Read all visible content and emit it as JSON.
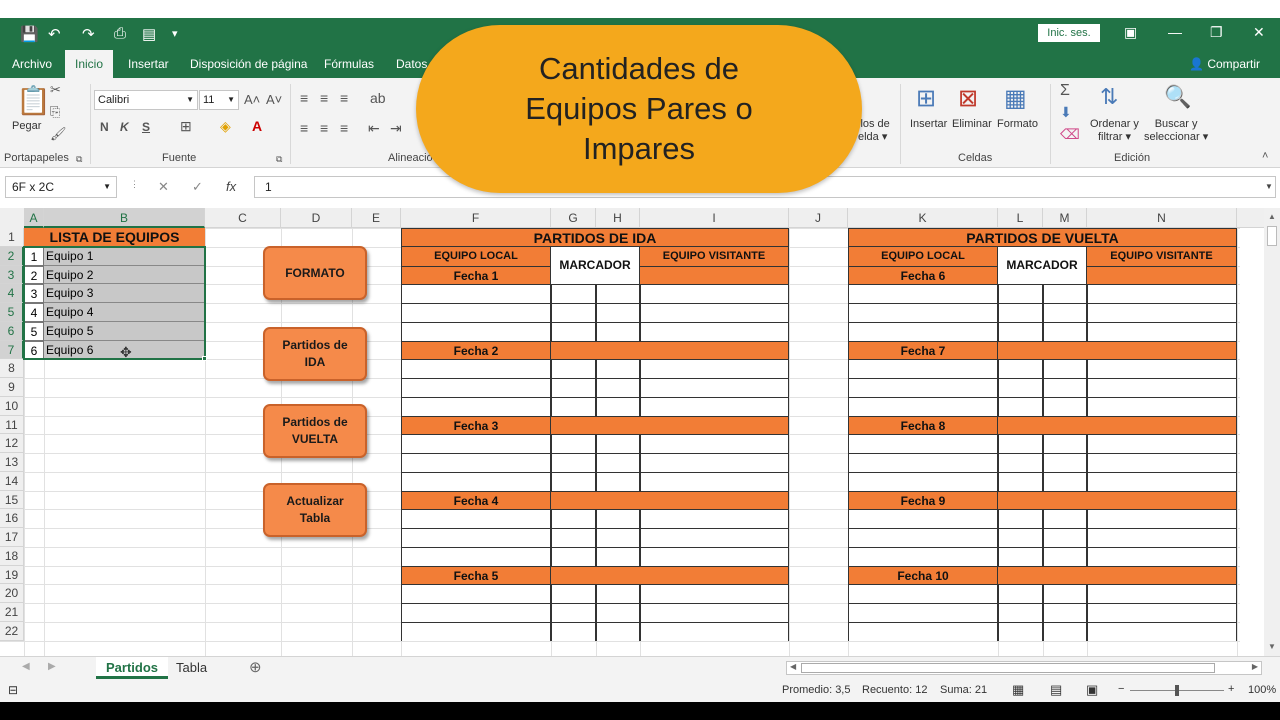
{
  "titlebar": {
    "signin": "Inic. ses."
  },
  "tabs": [
    "Archivo",
    "Inicio",
    "Insertar",
    "Disposición de página",
    "Fórmulas",
    "Datos"
  ],
  "share": "Compartir",
  "ribbon": {
    "paste": "Pegar",
    "font_name": "Calibri",
    "font_size": "11",
    "bold": "N",
    "italic": "K",
    "underline": "S",
    "groups": {
      "clipboard": "Portapapeles",
      "font": "Fuente",
      "alignment": "Alineació",
      "cells": "Celdas",
      "editing": "Edición"
    },
    "insert": "Insertar",
    "delete": "Eliminar",
    "format": "Formato",
    "cell_styles_1": "ilos de",
    "cell_styles_2": "elda",
    "sort_1": "Ordenar y",
    "sort_2": "filtrar",
    "find_1": "Buscar y",
    "find_2": "seleccionar"
  },
  "formula_bar": {
    "name_box": "6F x 2C",
    "value": "1",
    "fx": "fx"
  },
  "columns": [
    "A",
    "B",
    "C",
    "D",
    "E",
    "F",
    "G",
    "H",
    "I",
    "J",
    "K",
    "L",
    "M",
    "N"
  ],
  "rows": [
    "1",
    "2",
    "3",
    "4",
    "5",
    "6",
    "7",
    "8",
    "9",
    "10",
    "11",
    "12",
    "13",
    "14",
    "15",
    "16",
    "17",
    "18",
    "19",
    "20",
    "21",
    "22"
  ],
  "team_list": {
    "title": "LISTA DE EQUIPOS",
    "numbers": [
      "1",
      "2",
      "3",
      "4",
      "5",
      "6"
    ],
    "teams": [
      "Equipo 1",
      "Equipo 2",
      "Equipo 3",
      "Equipo 4",
      "Equipo 5",
      "Equipo 6"
    ]
  },
  "buttons": {
    "formato": "FORMATO",
    "ida_1": "Partidos de",
    "ida_2": "IDA",
    "vuelta_1": "Partidos de",
    "vuelta_2": "VUELTA",
    "actualizar_1": "Actualizar",
    "actualizar_2": "Tabla"
  },
  "ida": {
    "title": "PARTIDOS DE IDA",
    "local": "EQUIPO LOCAL",
    "marcador": "MARCADOR",
    "visitante": "EQUIPO VISITANTE",
    "fechas": [
      "Fecha 1",
      "Fecha 2",
      "Fecha 3",
      "Fecha 4",
      "Fecha 5"
    ]
  },
  "vuelta": {
    "title": "PARTIDOS DE VUELTA",
    "local": "EQUIPO LOCAL",
    "marcador": "MARCADOR",
    "visitante": "EQUIPO VISITANTE",
    "fechas": [
      "Fecha 6",
      "Fecha 7",
      "Fecha 8",
      "Fecha 9",
      "Fecha 10"
    ]
  },
  "sheet_tabs": [
    "Partidos",
    "Tabla"
  ],
  "status": {
    "average": "Promedio: 3,5",
    "count": "Recuento: 12",
    "sum": "Suma: 21",
    "zoom": "100%"
  },
  "banner": {
    "line1": "Cantidades de",
    "line2": "Equipos Pares o",
    "line3": "Impares"
  },
  "colors": {
    "excel_green": "#217346",
    "header_orange": "#f27d36",
    "banner": "#f4a81c"
  }
}
